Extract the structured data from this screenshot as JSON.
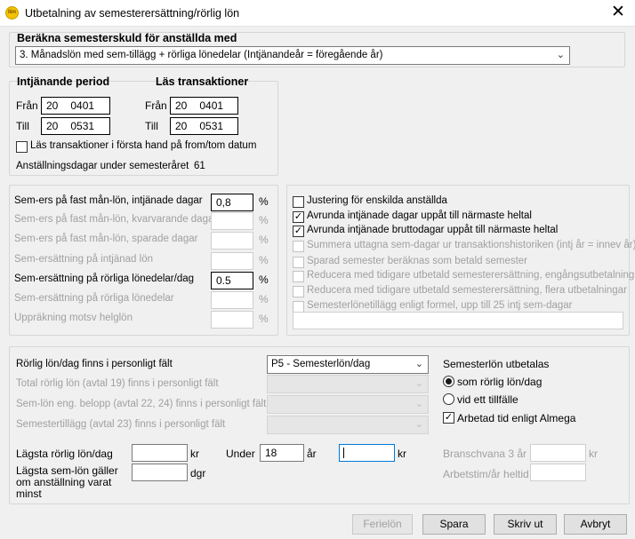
{
  "window": {
    "icon_text": "lön",
    "title": "Utbetalning av semesterersättning/rörlig lön",
    "close_glyph": "✕"
  },
  "calc": {
    "heading": "Beräkna semesterskuld för anställda med",
    "method_selected": "3.  Månadslön med sem-tillägg + rörliga lönedelar (Intjänandeår = föregående år)"
  },
  "period": {
    "earn_heading": "Intjänande period",
    "read_heading": "Läs transaktioner",
    "from_label": "Från",
    "to_label": "Till",
    "earn_from_a": "20",
    "earn_from_b": "0401",
    "earn_to_a": "20",
    "earn_to_b": "0531",
    "read_from_a": "20",
    "read_from_b": "0401",
    "read_to_a": "20",
    "read_to_b": "0531",
    "read_first_label": "Läs transaktioner i första hand på from/tom datum",
    "read_first_checked": false,
    "employment_days_label": "Anställningsdagar under semesteråret",
    "employment_days_value": "61"
  },
  "rates": [
    {
      "label": "Sem-ers på fast mån-lön, intjänade dagar",
      "value": "0,8",
      "unit": "%",
      "enabled": true
    },
    {
      "label": "Sem-ers på fast mån-lön, kvarvarande dagar",
      "value": "",
      "unit": "%",
      "enabled": false
    },
    {
      "label": "Sem-ers på fast mån-lön, sparade dagar",
      "value": "",
      "unit": "%",
      "enabled": false
    },
    {
      "label": "Sem-ersättning på intjänad lön",
      "value": "",
      "unit": "%",
      "enabled": false
    },
    {
      "label": "Sem-ersättning på rörliga lönedelar/dag",
      "value": "0.5",
      "unit": "%",
      "enabled": true
    },
    {
      "label": "Sem-ersättning på rörliga lönedelar",
      "value": "",
      "unit": "%",
      "enabled": false
    },
    {
      "label": "Uppräkning motsv helglön",
      "value": "",
      "unit": "%",
      "enabled": false
    }
  ],
  "options": [
    {
      "label": "Justering för enskilda anställda",
      "checked": false,
      "enabled": true
    },
    {
      "label": "Avrunda intjänade dagar uppåt till närmaste heltal",
      "checked": true,
      "enabled": true
    },
    {
      "label": "Avrunda intjänade bruttodagar uppåt till närmaste heltal",
      "checked": true,
      "enabled": true
    },
    {
      "label": "Summera uttagna sem-dagar ur transaktionshistoriken (intj år = innev år)",
      "checked": false,
      "enabled": false
    },
    {
      "label": "Sparad semester beräknas som betald semester",
      "checked": false,
      "enabled": false
    },
    {
      "label": "Reducera med tidigare utbetald semesterersättning, engångsutbetalning",
      "checked": false,
      "enabled": false
    },
    {
      "label": "Reducera med tidigare utbetald semesterersättning, flera utbetalningar",
      "checked": false,
      "enabled": false
    },
    {
      "label": "Semesterlönetillägg enligt formel, upp till 25 intj sem-dagar",
      "checked": false,
      "enabled": false
    }
  ],
  "options_extra_value": "",
  "fields": [
    {
      "label": "Rörlig lön/dag finns i personligt fält",
      "value": "P5 - Semesterlön/dag",
      "enabled": true
    },
    {
      "label": "Total rörlig lön (avtal 19) finns i personligt fält",
      "value": "",
      "enabled": false
    },
    {
      "label": "Sem-lön eng. belopp (avtal 22, 24) finns i personligt fält",
      "value": "",
      "enabled": false
    },
    {
      "label": "Semestertillägg (avtal 23) finns i personligt fält",
      "value": "",
      "enabled": false
    }
  ],
  "payout": {
    "heading": "Semesterlön utbetalas",
    "radio_variable": "som rörlig lön/dag",
    "radio_once": "vid ett tillfälle",
    "selected": "som rörlig lön/dag",
    "almega_label": "Arbetad tid enligt Almega",
    "almega_checked": true
  },
  "minimums": {
    "lowest_variable_label": "Lägsta rörlig lön/dag",
    "lowest_variable_value": "",
    "kr_unit": "kr",
    "under_label": "Under",
    "under_value": "18",
    "years_unit": "år",
    "under_amount_value": "",
    "kr_unit2": "kr",
    "lowest_sem_label": "Lägsta sem-lön gäller om anställning varat minst",
    "lowest_sem_value": "",
    "days_unit": "dgr",
    "branch_label": "Branschvana 3 år",
    "branch_value": "",
    "branch_unit": "kr",
    "hours_label": "Arbetstim/år heltid",
    "hours_value": ""
  },
  "buttons": {
    "holiday_wage": "Ferielön",
    "save": "Spara",
    "print": "Skriv ut",
    "cancel": "Avbryt"
  }
}
